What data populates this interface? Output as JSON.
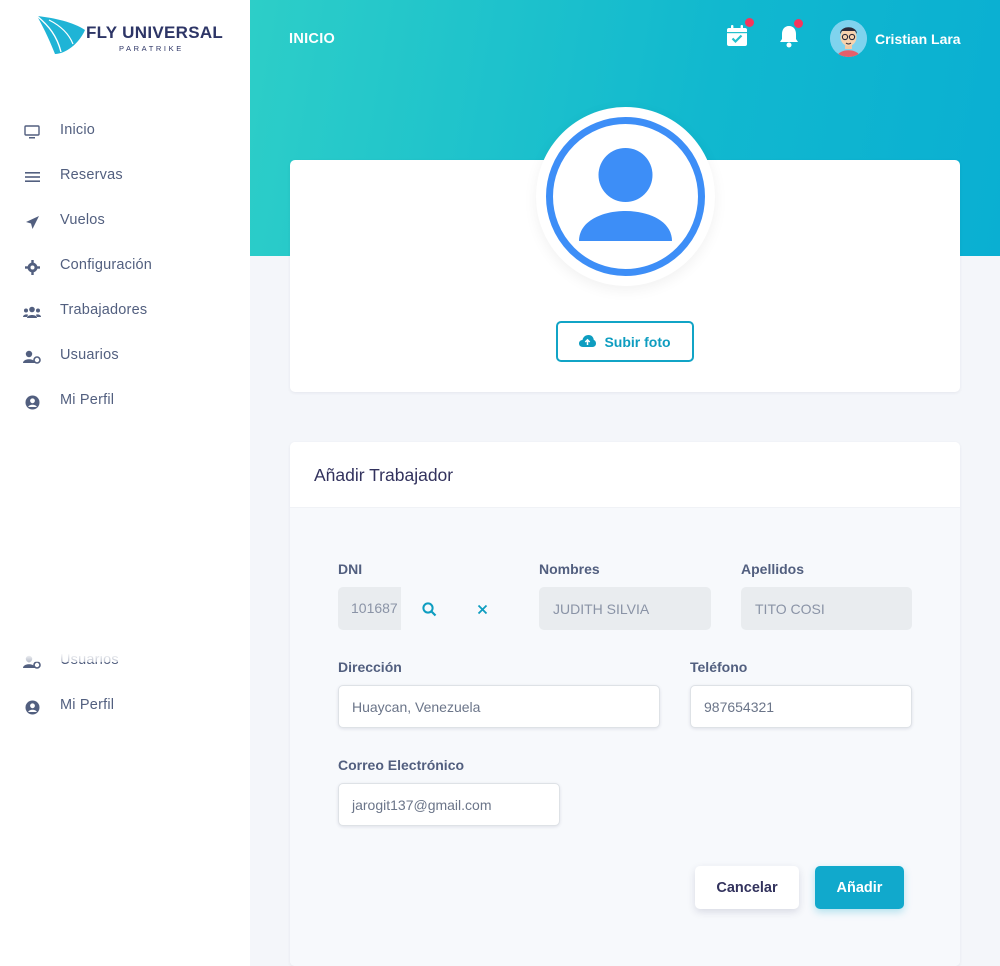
{
  "brand": {
    "name": "FLY UNIVERSAL",
    "subtitle": "PARATRIKE"
  },
  "sidebar": {
    "items": [
      {
        "label": "Inicio",
        "icon": "monitor-icon"
      },
      {
        "label": "Reservas",
        "icon": "list-icon"
      },
      {
        "label": "Vuelos",
        "icon": "send-icon"
      },
      {
        "label": "Configuración",
        "icon": "gear-icon"
      },
      {
        "label": "Trabajadores",
        "icon": "users-icon"
      },
      {
        "label": "Usuarios",
        "icon": "user-gear-icon"
      },
      {
        "label": "Mi Perfil",
        "icon": "user-circle-icon"
      }
    ],
    "repeated_items": [
      {
        "label": "Usuarios",
        "icon": "user-gear-icon"
      },
      {
        "label": "Mi Perfil",
        "icon": "user-circle-icon"
      }
    ]
  },
  "header": {
    "title": "INICIO",
    "user_name": "Cristian Lara"
  },
  "profile": {
    "upload_label": "Subir foto"
  },
  "form": {
    "title": "Añadir Trabajador",
    "dni": {
      "label": "DNI",
      "value": "101687"
    },
    "nombres": {
      "label": "Nombres",
      "value": "JUDITH SILVIA"
    },
    "apellidos": {
      "label": "Apellidos",
      "value": "TITO COSI"
    },
    "direccion": {
      "label": "Dirección",
      "value": "Huaycan, Venezuela"
    },
    "telefono": {
      "label": "Teléfono",
      "value": "987654321"
    },
    "correo": {
      "label": "Correo Electrónico",
      "value": "jarogit137@gmail.com"
    },
    "cancel_label": "Cancelar",
    "submit_label": "Añadir"
  },
  "colors": {
    "accent": "#11a9cc",
    "header_start": "#2dcec8",
    "header_end": "#0aafd2",
    "badge": "#f5365c",
    "avatar_blue": "#3d8ef7"
  }
}
